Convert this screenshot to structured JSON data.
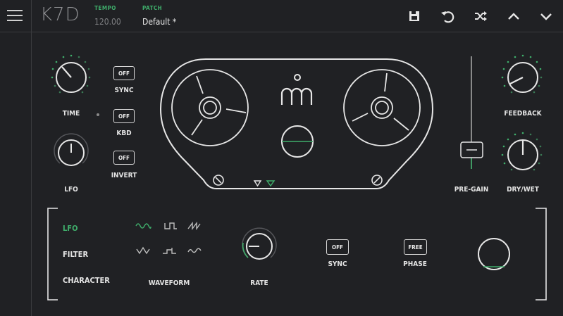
{
  "app": {
    "title": "K7D"
  },
  "header": {
    "tempo_label": "TEMPO",
    "tempo_value": "120.00",
    "patch_label": "PATCH",
    "patch_value": "Default *"
  },
  "delay": {
    "time_label": "TIME",
    "lfo_label": "LFO",
    "sync_label": "SYNC",
    "sync_value": "OFF",
    "kbd_label": "KBD",
    "kbd_value": "OFF",
    "invert_label": "INVERT",
    "invert_value": "OFF",
    "pregain_label": "PRE-GAIN",
    "feedback_label": "FEEDBACK",
    "drywet_label": "DRY/WET"
  },
  "mod": {
    "tabs": [
      "LFO",
      "FILTER",
      "CHARACTER"
    ],
    "active_tab": "LFO",
    "waveform_label": "WAVEFORM",
    "rate_label": "RATE",
    "sync_label": "SYNC",
    "sync_value": "OFF",
    "phase_label": "PHASE",
    "phase_value": "FREE"
  },
  "colors": {
    "accent": "#3fae6b",
    "background": "#202124",
    "line": "#d8d8d8"
  },
  "icons": [
    "menu-icon",
    "save-icon",
    "undo-icon",
    "shuffle-icon",
    "chevron-up-icon",
    "chevron-down-icon",
    "logo-icon"
  ]
}
